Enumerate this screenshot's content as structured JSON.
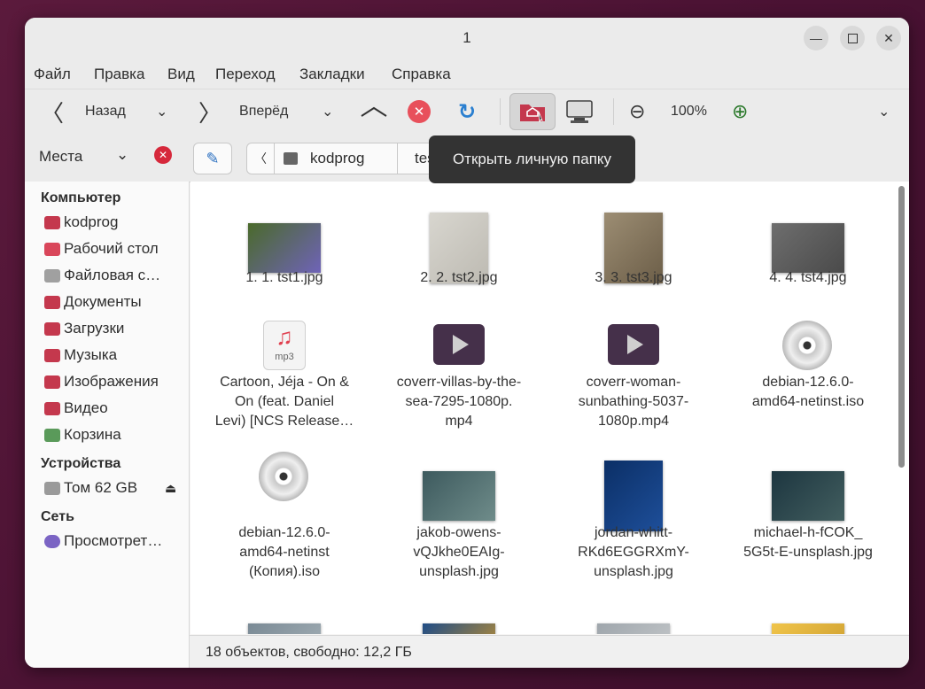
{
  "window": {
    "title": "1",
    "minimize_icon": "minimize-icon",
    "maximize_icon": "maximize-icon",
    "close_icon": "close-icon"
  },
  "menubar": [
    "Файл",
    "Правка",
    "Вид",
    "Переход",
    "Закладки",
    "Справка"
  ],
  "toolbar": {
    "back": "Назад",
    "forward": "Вперёд",
    "zoom": "100%"
  },
  "location": {
    "places": "Места",
    "path": [
      "kodprog",
      "test"
    ]
  },
  "tooltip": "Открыть личную папку",
  "sidebar": {
    "computer_header": "Компьютер",
    "computer": [
      {
        "label": "kodprog",
        "color": "#c4384d"
      },
      {
        "label": "Рабочий стол",
        "color": "#d9465a"
      },
      {
        "label": "Файловая с…",
        "color": "#a0a0a0"
      },
      {
        "label": "Документы",
        "color": "#c4384d"
      },
      {
        "label": "Загрузки",
        "color": "#c4384d"
      },
      {
        "label": "Музыка",
        "color": "#c4384d"
      },
      {
        "label": "Изображения",
        "color": "#c4384d"
      },
      {
        "label": "Видео",
        "color": "#c4384d"
      },
      {
        "label": "Корзина",
        "color": "#5a9a5a"
      }
    ],
    "devices_header": "Устройства",
    "devices": [
      {
        "label": "Том 62 GB"
      }
    ],
    "network_header": "Сеть",
    "network": [
      {
        "label": "Просмотрет…"
      }
    ]
  },
  "files": [
    {
      "lines": [
        "1. 1. tst1.jpg"
      ],
      "kind": "photo",
      "colors": [
        "#4a6a2a",
        "#6f63b8"
      ]
    },
    {
      "lines": [
        "2. 2. tst2.jpg"
      ],
      "kind": "photo",
      "colors": [
        "#d8d6cf",
        "#bdbab2"
      ]
    },
    {
      "lines": [
        "3. 3. tst3.jpg"
      ],
      "kind": "photo",
      "colors": [
        "#9c8d73",
        "#6c5e48"
      ]
    },
    {
      "lines": [
        "4. 4. tst4.jpg"
      ],
      "kind": "photo",
      "colors": [
        "#6e6e6e",
        "#4a4a4a"
      ]
    },
    {
      "lines": [
        "Cartoon, Jéja - On &",
        "On (feat. Daniel",
        "Levi) [NCS Release…"
      ],
      "kind": "audio",
      "badge": "mp3"
    },
    {
      "lines": [
        "coverr-villas-by-the-",
        "sea-7295-1080p.",
        "mp4"
      ],
      "kind": "video"
    },
    {
      "lines": [
        "coverr-woman-",
        "sunbathing-5037-",
        "1080p.mp4"
      ],
      "kind": "video"
    },
    {
      "lines": [
        "debian-12.6.0-",
        "amd64-netinst.iso"
      ],
      "kind": "disc"
    },
    {
      "lines": [
        "debian-12.6.0-",
        "amd64-netinst",
        "(Копия).iso"
      ],
      "kind": "disc"
    },
    {
      "lines": [
        "jakob-owens-",
        "vQJkhe0EAIg-",
        "unsplash.jpg"
      ],
      "kind": "photo",
      "colors": [
        "#3d5a5e",
        "#6f8c8a"
      ]
    },
    {
      "lines": [
        "jordan-whitt-",
        "RKd6EGGRXmY-",
        "unsplash.jpg"
      ],
      "kind": "photo",
      "colors": [
        "#0b2f66",
        "#1e4f9a"
      ]
    },
    {
      "lines": [
        "michael-h-fCOK_",
        "5G5t-E-unsplash.jpg"
      ],
      "kind": "photo",
      "colors": [
        "#1d3640",
        "#425e5f"
      ]
    },
    {
      "lines": [],
      "kind": "photo",
      "colors": [
        "#7a8a95",
        "#a9b4ba"
      ]
    },
    {
      "lines": [],
      "kind": "photo",
      "colors": [
        "#1f4c86",
        "#d59a27"
      ]
    },
    {
      "lines": [],
      "kind": "photo",
      "colors": [
        "#9fa6ac",
        "#c9ccce"
      ]
    },
    {
      "lines": [],
      "kind": "photo",
      "colors": [
        "#f0c44a",
        "#c99a2d"
      ]
    }
  ],
  "status": "18 объектов, свободно: 12,2 ГБ"
}
